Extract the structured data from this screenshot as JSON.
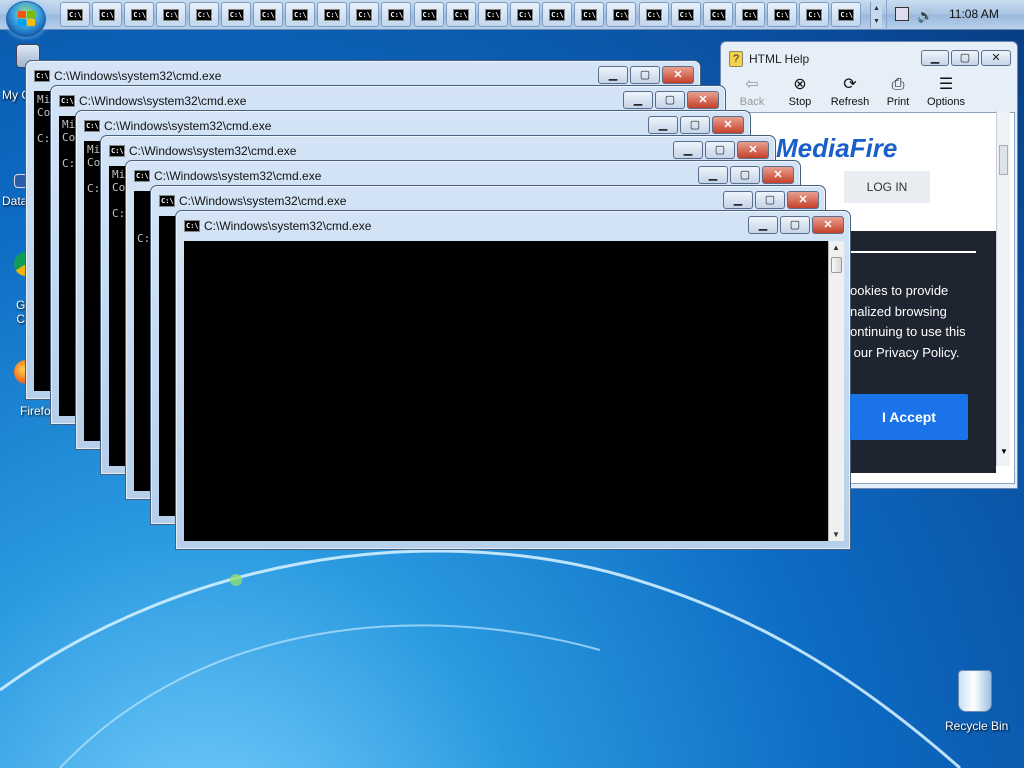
{
  "taskbar": {
    "button_count": 25,
    "button_icon": "C:\\.",
    "clock": "11:08 AM"
  },
  "desktop_icons": [
    {
      "label": "My C",
      "icon": "computer-icon"
    },
    {
      "label": "Data",
      "icon": "data-icon"
    },
    {
      "label": "G\nC",
      "icon": "chrome-icon"
    },
    {
      "label": "Firefo",
      "icon": "firefox-icon"
    },
    {
      "label": "Recycle Bin",
      "icon": "recycle-bin-icon"
    }
  ],
  "help_window": {
    "title": "HTML Help",
    "toolbar": [
      {
        "label": "Back",
        "icon": "back-icon",
        "enabled": false
      },
      {
        "label": "Stop",
        "icon": "stop-icon",
        "enabled": true
      },
      {
        "label": "Refresh",
        "icon": "refresh-icon",
        "enabled": true
      },
      {
        "label": "Print",
        "icon": "print-icon",
        "enabled": true
      },
      {
        "label": "Options",
        "icon": "options-icon",
        "enabled": true
      }
    ],
    "content": {
      "logo": "MediaFire",
      "login_label": "LOG IN",
      "cookie_lines": [
        "ookies to provide",
        "nalized browsing",
        "ontinuing to use this",
        " our Privacy Policy."
      ],
      "accept_label": "I Accept"
    }
  },
  "cmd_windows": [
    {
      "title": "C:\\Windows\\system32\\cmd.exe",
      "lines": [
        "Mi",
        "Co",
        "",
        "C:"
      ]
    },
    {
      "title": "C:\\Windows\\system32\\cmd.exe",
      "lines": [
        "Mi",
        "Co",
        "",
        "C:"
      ]
    },
    {
      "title": "C:\\Windows\\system32\\cmd.exe",
      "lines": [
        "Mi",
        "Co",
        "",
        "C:"
      ]
    },
    {
      "title": "C:\\Windows\\system32\\cmd.exe",
      "lines": [
        "Mi",
        "Co",
        "",
        "C:"
      ]
    },
    {
      "title": "C:\\Windows\\system32\\cmd.exe",
      "lines": [
        "",
        "",
        "",
        "C:"
      ]
    },
    {
      "title": "C:\\Windows\\system32\\cmd.exe",
      "lines": []
    },
    {
      "title": "C:\\Windows\\system32\\cmd.exe",
      "lines": []
    }
  ],
  "colors": {
    "desktop": "#0d6cc4",
    "accept_button": "#1a73e8",
    "close_button": "#c4402a"
  }
}
